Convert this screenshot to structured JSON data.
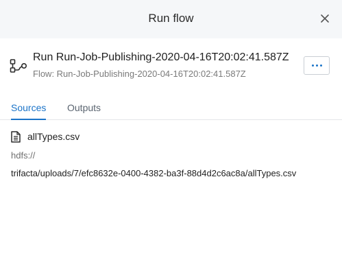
{
  "dialog": {
    "title": "Run flow",
    "close_icon": "close-icon"
  },
  "run": {
    "icon": "flow-icon",
    "title": "Run Run-Job-Publishing-2020-04-16T20:02:41.587Z",
    "flow_label": "Flow: Run-Job-Publishing-2020-04-16T20:02:41.587Z",
    "more_icon": "ellipsis-icon"
  },
  "tabs": [
    {
      "label": "Sources",
      "active": true
    },
    {
      "label": "Outputs",
      "active": false
    }
  ],
  "source": {
    "icon": "file-icon",
    "name": "allTypes.csv",
    "scheme": "hdfs://",
    "path": "trifacta/uploads/7/efc8632e-0400-4382-ba3f-88d4d2c6ac8a/allTypes.csv"
  },
  "colors": {
    "accent": "#1a73c8",
    "header_bg": "#f5f7f9",
    "divider": "#e3e6e9"
  }
}
